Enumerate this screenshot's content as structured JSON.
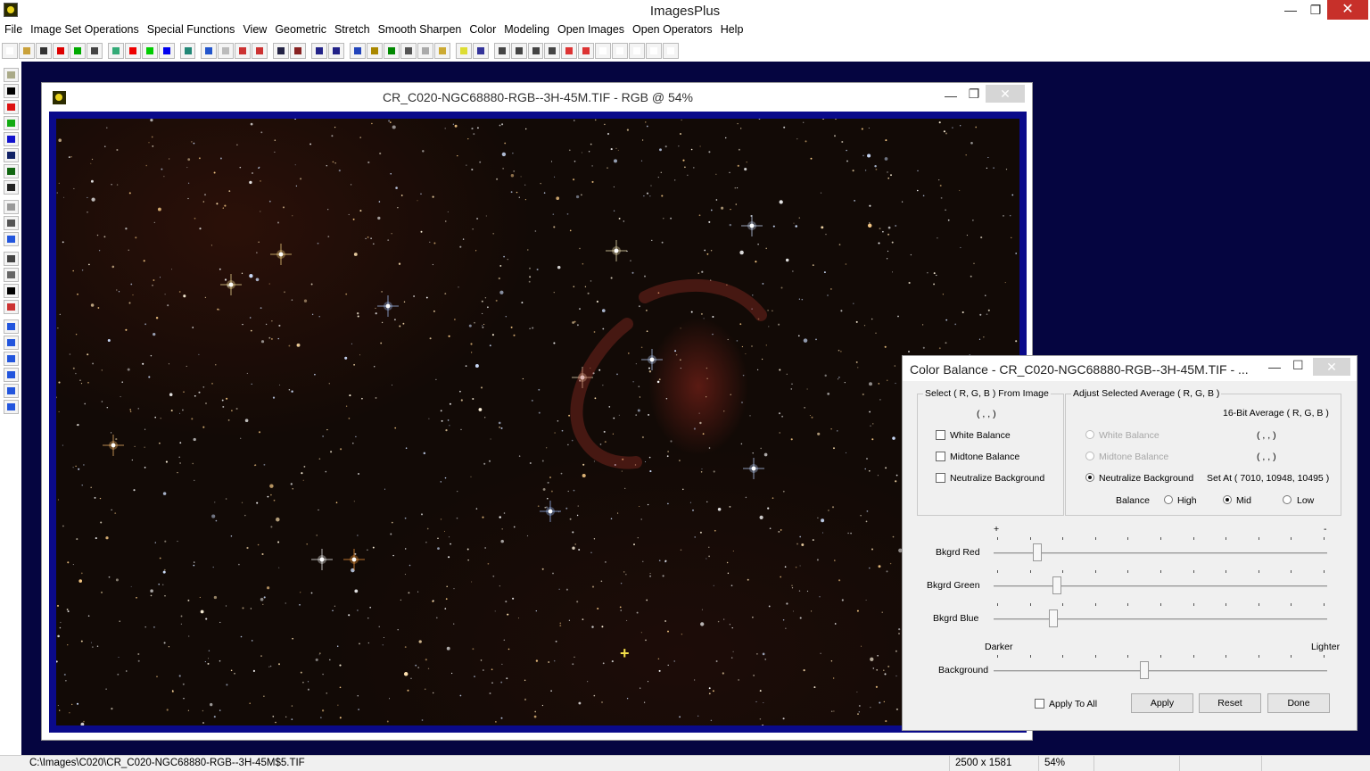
{
  "app": {
    "title": "ImagesPlus",
    "minimize": "—",
    "maximize": "❐",
    "close": "✕"
  },
  "menu": [
    "File",
    "Image Set Operations",
    "Special Functions",
    "View",
    "Geometric",
    "Stretch",
    "Smooth Sharpen",
    "Color",
    "Modeling",
    "Open Images",
    "Open Operators",
    "Help"
  ],
  "image_window": {
    "title": "CR_C020-NGC68880-RGB--3H-45M.TIF - RGB @ 54%",
    "minimize": "—",
    "maximize": "❐",
    "close": "✕",
    "crosshair": "+"
  },
  "color_balance": {
    "title": "Color Balance - CR_C020-NGC68880-RGB--3H-45M.TIF - ...",
    "minimize": "—",
    "maximize": "☐",
    "close": "✕",
    "select_group": {
      "title": "Select ( R, G, B ) From Image",
      "value": "( , , )",
      "white_balance": "White Balance",
      "midtone_balance": "Midtone Balance",
      "neutralize_background": "Neutralize Background"
    },
    "adjust_group": {
      "title": "Adjust Selected Average ( R, G, B )",
      "header": "16-Bit Average ( R, G, B )",
      "white_balance": "White Balance",
      "white_value": "( , , )",
      "midtone_balance": "Midtone Balance",
      "midtone_value": "( , , )",
      "neutralize_background": "Neutralize Background",
      "neutralize_value": "Set At ( 7010, 10948, 10495 )",
      "balance_label": "Balance",
      "high": "High",
      "mid": "Mid",
      "low": "Low",
      "selected_mode": "Neutralize Background",
      "selected_balance": "Mid"
    },
    "plus": "+",
    "minus": "-",
    "sliders": [
      {
        "label": "Bkgrd Red",
        "value": 0.12
      },
      {
        "label": "Bkgrd Green",
        "value": 0.18
      },
      {
        "label": "Bkgrd Blue",
        "value": 0.17
      },
      {
        "label": "Background",
        "value": 0.45
      }
    ],
    "darker": "Darker",
    "lighter": "Lighter",
    "apply_to_all": "Apply To All",
    "apply": "Apply",
    "reset": "Reset",
    "done": "Done"
  },
  "status": {
    "path": "C:\\Images\\C020\\CR_C020-NGC68880-RGB--3H-45M$5.TIF",
    "dimensions": "2500 x 1581",
    "zoom": "54%"
  },
  "colors": {
    "workspace": "#050540",
    "image_frame": "#0a0a8a",
    "close_red": "#c7302a"
  }
}
